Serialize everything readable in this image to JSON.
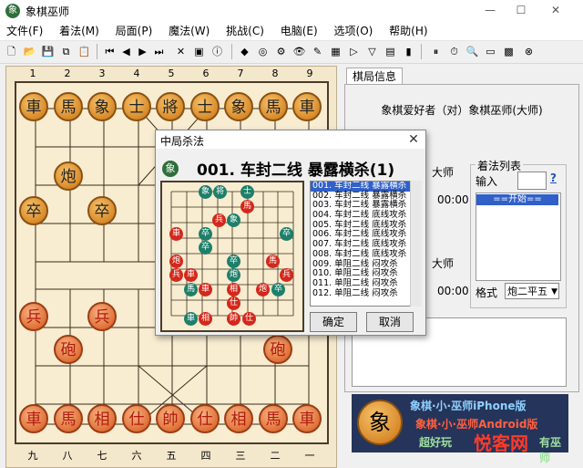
{
  "window": {
    "title": "象棋巫师",
    "icon_char": "象"
  },
  "menu": [
    "文件(F)",
    "着法(M)",
    "局面(P)",
    "魔法(W)",
    "挑战(C)",
    "电脑(E)",
    "选项(O)",
    "帮助(H)"
  ],
  "board": {
    "top_numbers": [
      "1",
      "2",
      "3",
      "4",
      "5",
      "6",
      "7",
      "8",
      "9"
    ],
    "bottom_numbers": [
      "九",
      "八",
      "七",
      "六",
      "五",
      "四",
      "三",
      "二",
      "一"
    ],
    "black_pieces": [
      "車",
      "馬",
      "象",
      "士",
      "將",
      "士",
      "象",
      "馬",
      "車",
      "炮",
      "卒",
      "卒"
    ],
    "red_pieces": [
      "兵",
      "兵",
      "砲",
      "砲",
      "車",
      "馬",
      "相",
      "仕",
      "帥",
      "仕",
      "相",
      "馬",
      "車"
    ]
  },
  "panel": {
    "tab_label": "棋局信息",
    "vs_title": "象棋爱好者（对）象棋巫师(大师)",
    "master_label_1": "大师",
    "time_1": "00:00",
    "master_label_2": "大师",
    "time_2": "00:00",
    "moves_legend": "着法列表",
    "input_label": "输入",
    "help_glyph": "?",
    "move_list_start": "==开始==",
    "format_label": "格式",
    "format_value": "炮二平五",
    "ad_lines": [
      "象棋·小·巫师iPhone版",
      "象棋·小·巫师Android版",
      "超好玩",
      "有巫师"
    ]
  },
  "dialog": {
    "title": "中局杀法",
    "heading": "001. 车封二线  暴露横杀(1)",
    "list_items": [
      "001. 车封二线  暴露横杀",
      "002. 车封二线  暴露横杀",
      "003. 车封二线  暴露横杀",
      "004. 车封二线  底线攻杀",
      "005. 车封二线  底线攻杀",
      "006. 车封二线  底线攻杀",
      "007. 车封二线  底线攻杀",
      "008. 车封二线  底线攻杀",
      "009. 单阻二线  闷攻杀",
      "010. 单阻二线  闷攻杀",
      "011. 单阻二线  闷攻杀",
      "012. 单阻二线  闷攻杀"
    ],
    "ok_label": "确定",
    "cancel_label": "取消"
  },
  "watermark": "悦客网"
}
